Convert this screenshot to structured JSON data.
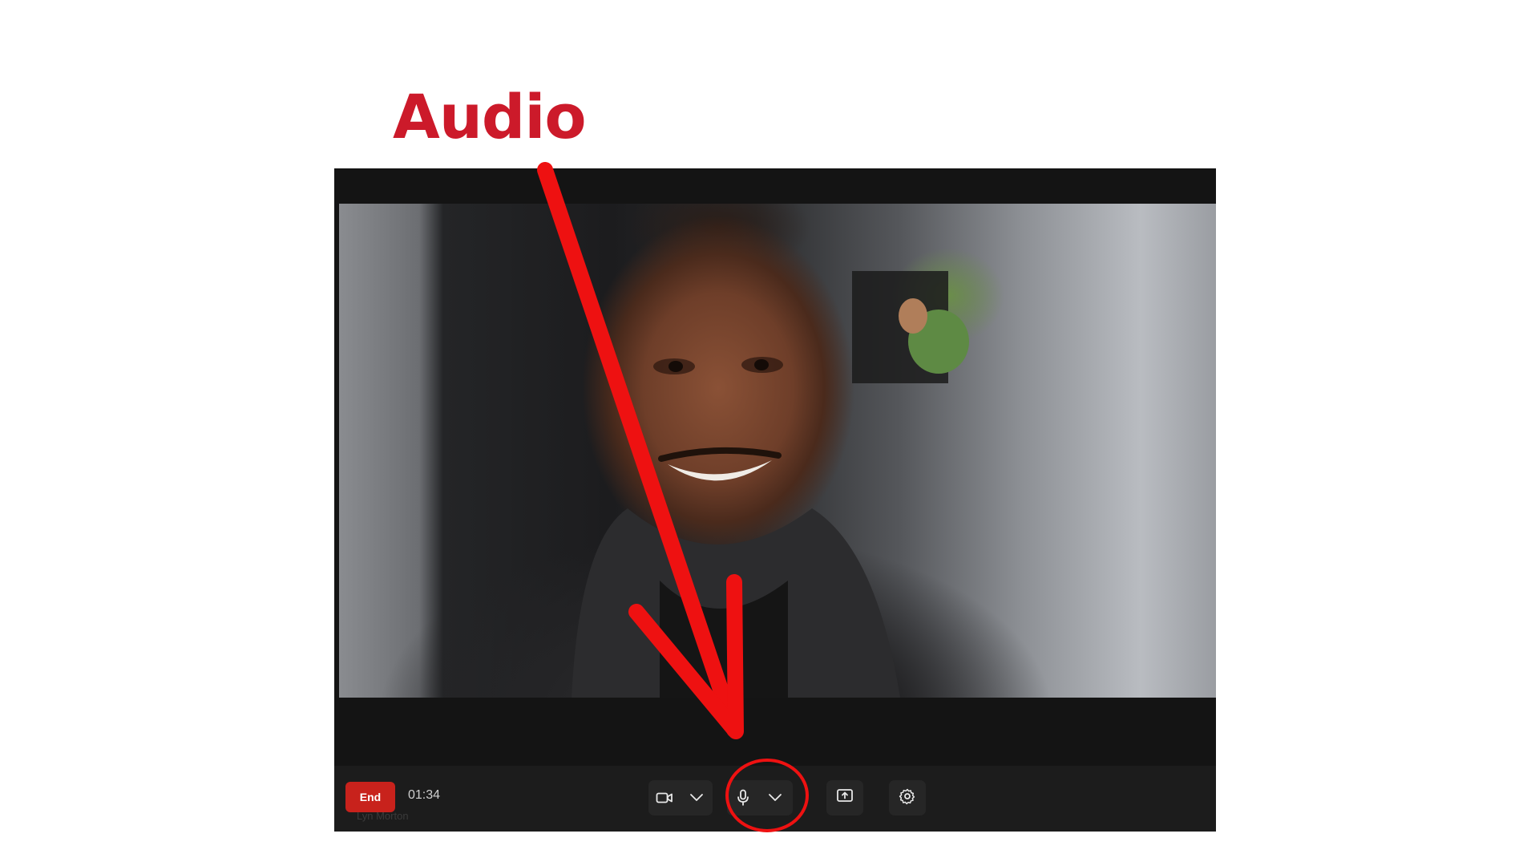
{
  "annotation": {
    "headline": "Audio",
    "accent_color": "#cc1a2a",
    "marker_color": "#ee1111"
  },
  "call": {
    "end_label": "End",
    "elapsed_time": "01:34",
    "participant_name": "Lyn Morton"
  },
  "controls": {
    "camera_icon": "video-camera-icon",
    "microphone_icon": "microphone-icon",
    "share_icon": "share-screen-icon",
    "settings_icon": "gear-icon"
  }
}
